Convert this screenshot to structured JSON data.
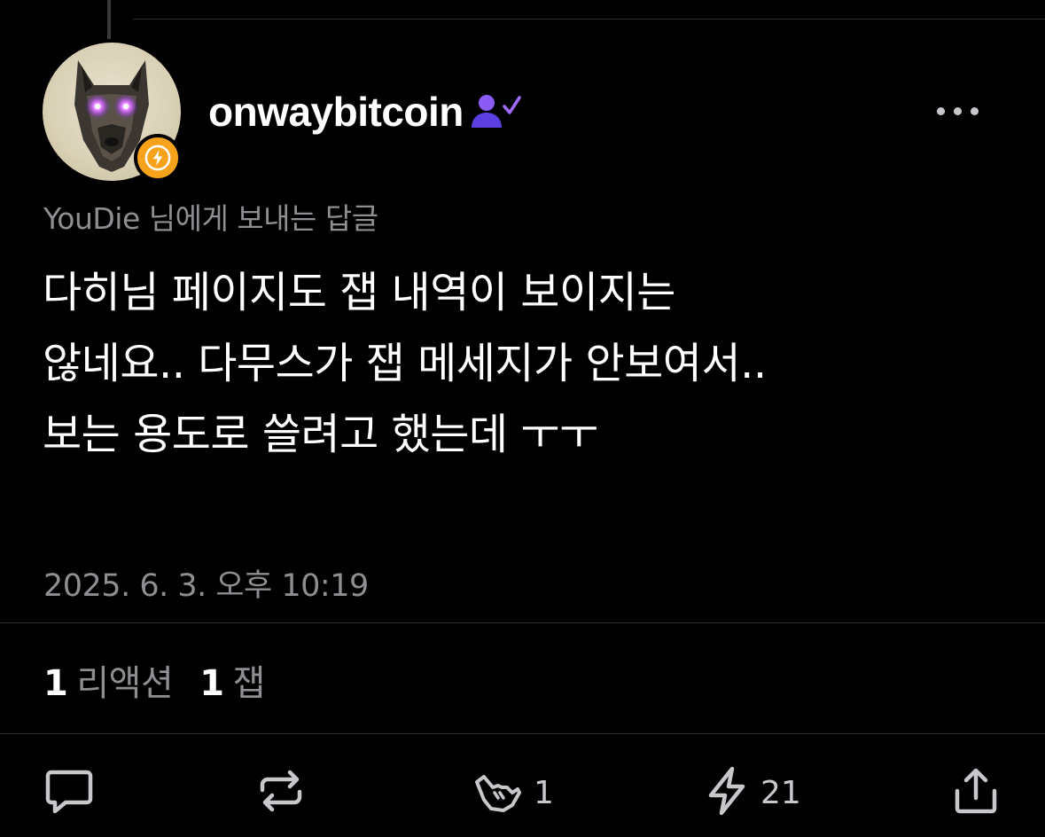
{
  "post": {
    "username": "onwaybitcoin",
    "reply_to": "YouDie 님에게 보내는 답글",
    "body_lines": [
      "다히님 페이지도 잽 내역이 보이지는",
      "않네요.. 다무스가 잽 메세지가 안보여서..",
      "보는 용도로 쓸려고 했는데 ㅜㅜ"
    ],
    "timestamp": "2025. 6. 3. 오후 10:19"
  },
  "stats": {
    "reactions_count": "1",
    "reactions_label": "리액션",
    "zaps_count": "1",
    "zaps_label": "잽"
  },
  "actions": {
    "reply_icon": "comment-icon",
    "repost_icon": "repost-icon",
    "reaction_icon": "shaka-hand-icon",
    "reaction_count": "1",
    "zap_icon": "lightning-icon",
    "zap_count": "21",
    "share_icon": "share-icon"
  },
  "colors": {
    "background": "#000000",
    "secondary_text": "#8e8e93",
    "badge": "#f7a21b",
    "verified": "#6a4cf0"
  }
}
